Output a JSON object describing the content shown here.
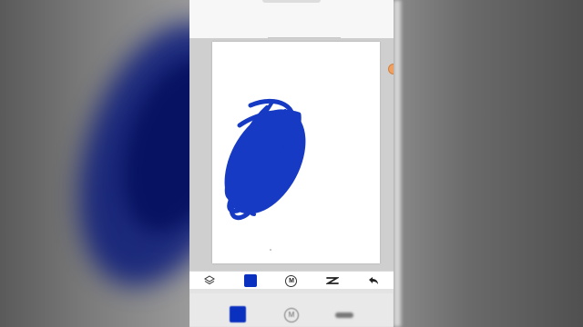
{
  "colors": {
    "brush_color": "#0a30c0",
    "paper": "#ffffff",
    "workspace": "#cfcfcf"
  },
  "toolbar": {
    "tools": [
      {
        "icon": "layers-icon"
      },
      {
        "icon": "color-swatch",
        "color": "#0a30c0"
      },
      {
        "icon": "mode-circle-icon",
        "label": "M"
      },
      {
        "icon": "brush-icon"
      },
      {
        "icon": "undo-arrow-icon"
      }
    ]
  },
  "ghostbar": {
    "mode_label": "M"
  }
}
